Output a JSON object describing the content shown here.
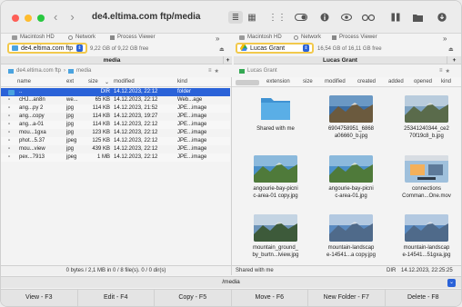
{
  "window": {
    "title": "de4.eltima.com ftp/media"
  },
  "colors": {
    "accent": "#2a62d8",
    "highlight": "#f2c94c",
    "folder": "#4aa3df"
  },
  "tabs": {
    "left": [
      {
        "label": "Macintosh HD"
      },
      {
        "label": "Network"
      },
      {
        "label": "Process Viewer"
      }
    ],
    "right": [
      {
        "label": "Macintosh HD"
      },
      {
        "label": "Network"
      },
      {
        "label": "Process Viewer"
      }
    ],
    "more": "»"
  },
  "left": {
    "location": "de4.eltima.com ftp",
    "free": "9,22 GB of 9,22 GB free",
    "panel_title": "media",
    "crumbs": [
      "de4.eltima.com ftp",
      "media"
    ],
    "columns": [
      "name",
      "ext",
      "size",
      "modified",
      "kind"
    ],
    "rows": [
      {
        "name": "..",
        "ext": "",
        "size": "DIR",
        "modified": "14.12.2023, 22:12",
        "kind": "folder"
      },
      {
        "name": "cHJ...an8n",
        "ext": "we...",
        "size": "65 KB",
        "modified": "14.12.2023, 22:12",
        "kind": "Web...age"
      },
      {
        "name": "ang...py 2",
        "ext": "jpg",
        "size": "114 KB",
        "modified": "14.12.2023, 21:52",
        "kind": "JPE...image"
      },
      {
        "name": "ang...copy",
        "ext": "jpg",
        "size": "114 KB",
        "modified": "14.12.2023, 19:27",
        "kind": "JPE...image"
      },
      {
        "name": "ang...a-01",
        "ext": "jpg",
        "size": "114 KB",
        "modified": "14.12.2023, 22:12",
        "kind": "JPE...image"
      },
      {
        "name": "mou...1gxa",
        "ext": "jpg",
        "size": "123 KB",
        "modified": "14.12.2023, 22:12",
        "kind": "JPE...image"
      },
      {
        "name": "phot...5.37",
        "ext": "jpeg",
        "size": "125 KB",
        "modified": "14.12.2023, 22:12",
        "kind": "JPE...image"
      },
      {
        "name": "mou...view",
        "ext": "jpg",
        "size": "439 KB",
        "modified": "14.12.2023, 22:12",
        "kind": "JPE...image"
      },
      {
        "name": "pex...7913",
        "ext": "jpeg",
        "size": "1 MB",
        "modified": "14.12.2023, 22:12",
        "kind": "JPE...image"
      }
    ],
    "status": "0 bytes / 2,1 MB in 0 / 8 file(s). 0 / 0 dir(s)"
  },
  "right": {
    "location": "Lucas Grant",
    "free": "16,54 GB of 16,11 GB free",
    "panel_title": "Lucas Grant",
    "crumbs": [
      "Lucas Grant"
    ],
    "columns": [
      "extension",
      "size",
      "modified",
      "created",
      "added",
      "opened",
      "kind"
    ],
    "items": [
      {
        "caption": "Shared with me",
        "type": "folder"
      },
      {
        "caption": "6904758951_6868\na06660_b.jpg",
        "type": "image"
      },
      {
        "caption": "25341240344_ce2\n70f19c8_b.jpg",
        "type": "image"
      },
      {
        "caption": "angourie-bay-picni\nc-area-01 copy.jpg",
        "type": "image"
      },
      {
        "caption": "angourie-bay-picni\nc-area-01.jpg",
        "type": "image"
      },
      {
        "caption": "connections\nComman...One.mov",
        "type": "video"
      },
      {
        "caption": "mountain_ground_\nby_burtn...lview.jpg",
        "type": "image"
      },
      {
        "caption": "mountain-landscap\ne-14541...a copy.jpg",
        "type": "image"
      },
      {
        "caption": "mountain-landscap\ne-14541...51gxa.jpg",
        "type": "image"
      }
    ],
    "status_left": "Shared with me",
    "status_kind": "DIR",
    "status_date": "14.12.2023, 22:25:25"
  },
  "command_line": "/media",
  "fkeys": [
    "View - F3",
    "Edit - F4",
    "Copy - F5",
    "Move - F6",
    "New Folder - F7",
    "Delete - F8"
  ]
}
